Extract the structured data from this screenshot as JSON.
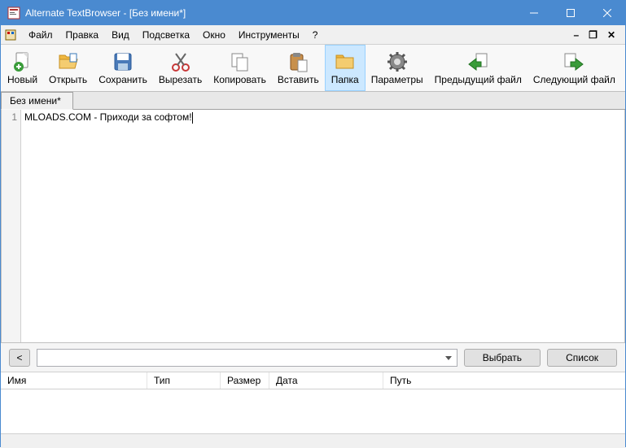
{
  "title": "Alternate TextBrowser - [Без имени*]",
  "menu": {
    "file": "Файл",
    "edit": "Правка",
    "view": "Вид",
    "highlight": "Подсветка",
    "window": "Окно",
    "tools": "Инструменты",
    "help": "?"
  },
  "toolbar": {
    "new": "Новый",
    "open": "Открыть",
    "save": "Сохранить",
    "cut": "Вырезать",
    "copy": "Копировать",
    "paste": "Вставить",
    "folder": "Папка",
    "params": "Параметры",
    "prev": "Предыдущий файл",
    "next": "Следующий файл"
  },
  "tab": {
    "label": "Без имени*"
  },
  "editor": {
    "line_no": "1",
    "text": "MLOADS.COM - Приходи за софтом!"
  },
  "bottom": {
    "back": "<",
    "choose": "Выбрать",
    "list": "Список"
  },
  "columns": {
    "name": "Имя",
    "type": "Тип",
    "size": "Размер",
    "date": "Дата",
    "path": "Путь"
  }
}
